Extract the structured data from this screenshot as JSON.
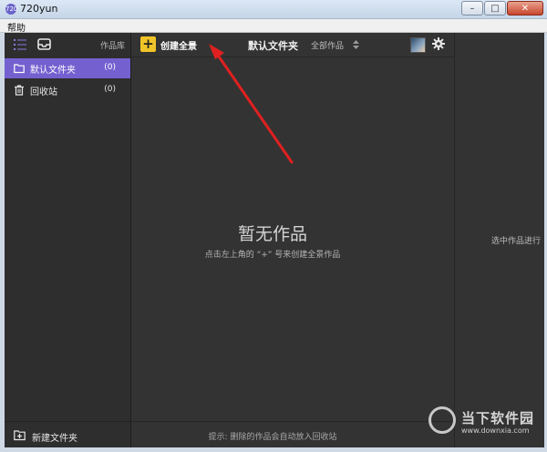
{
  "window": {
    "title": "720yun",
    "app_icon": "720",
    "menu": [
      "帮助"
    ],
    "controls": [
      "minimize",
      "maximize",
      "close"
    ]
  },
  "sidebar": {
    "library_label": "作品库",
    "folders": [
      {
        "label": "默认文件夹",
        "count": "(0)",
        "icon": "folder-icon",
        "active": true
      },
      {
        "label": "回收站",
        "count": "(0)",
        "icon": "trash-icon",
        "active": false
      }
    ],
    "new_folder_label": "新建文件夹"
  },
  "toolbar": {
    "create_label": "创建全景",
    "plus_glyph": "+",
    "folder_title": "默认文件夹",
    "filter_label": "全部作品"
  },
  "empty_state": {
    "title": "暂无作品",
    "subtitle": "点击左上角的 “+” 号来创建全景作品"
  },
  "footer_hint": "提示: 删除的作品会自动放入回收站",
  "right_panel": {
    "hint": "选中作品进行"
  },
  "watermark": {
    "name": "当下软件园",
    "url": "www.downxia.com"
  },
  "colors": {
    "accent": "#7560d0",
    "create_button": "#f0c428",
    "annotation_arrow": "#e02020",
    "background": "#333333"
  }
}
